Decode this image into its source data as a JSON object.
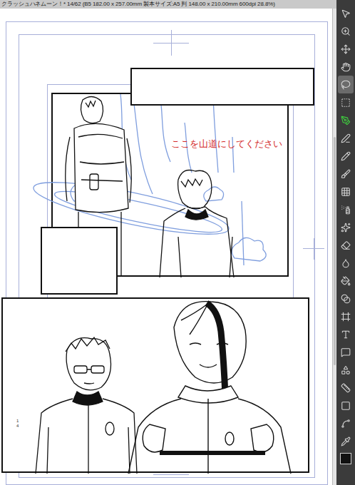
{
  "window": {
    "title": "クラッシュハネムーン！* 14/62 (B5 182.00 x 257.00mm 製本サイズ:A5 判 148.00 x 210.00mm 600dpi 28.8%)"
  },
  "canvas": {
    "annotation": "ここを山道にしてください",
    "page_number": "14"
  },
  "toolbar": {
    "tools": [
      {
        "selected": false,
        "color": "#d8d8d8"
      },
      {
        "selected": false,
        "color": "#d8d8d8"
      },
      {
        "selected": false,
        "color": "#d8d8d8"
      },
      {
        "selected": false,
        "color": "#d8d8d8"
      },
      {
        "selected": true,
        "color": "#d8d8d8"
      },
      {
        "selected": false,
        "color": "#d8d8d8"
      },
      {
        "selected": false,
        "color": "#3fd43f"
      },
      {
        "selected": false,
        "color": "#d8d8d8"
      },
      {
        "selected": false,
        "color": "#d8d8d8"
      },
      {
        "selected": false,
        "color": "#d8d8d8"
      },
      {
        "selected": false,
        "color": "#d8d8d8"
      },
      {
        "selected": false,
        "color": "#d8d8d8"
      },
      {
        "selected": false,
        "color": "#d8d8d8"
      },
      {
        "selected": false,
        "color": "#d8d8d8"
      },
      {
        "selected": false,
        "color": "#d8d8d8"
      },
      {
        "selected": false,
        "color": "#d8d8d8"
      },
      {
        "selected": false,
        "color": "#d8d8d8"
      },
      {
        "selected": false,
        "color": "#d8d8d8"
      },
      {
        "selected": false,
        "color": "#d8d8d8"
      },
      {
        "selected": false,
        "color": "#d8d8d8"
      },
      {
        "selected": false,
        "color": "#d8d8d8"
      },
      {
        "selected": false,
        "color": "#d8d8d8"
      },
      {
        "selected": false,
        "color": "#d8d8d8"
      },
      {
        "selected": false,
        "color": "#d8d8d8"
      },
      {
        "selected": false,
        "color": "#d8d8d8"
      }
    ],
    "color_swatch": {
      "color": "#111111"
    }
  }
}
